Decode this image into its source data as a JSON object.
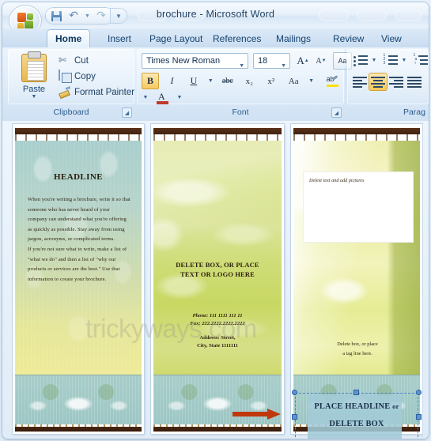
{
  "window": {
    "title": "brochure - Microsoft Word",
    "office_button": "office-button",
    "quick_access": [
      {
        "name": "save",
        "label": "Save",
        "icon": "save-icon"
      },
      {
        "name": "undo",
        "label": "Undo",
        "icon": "undo-icon"
      },
      {
        "name": "redo",
        "label": "Redo",
        "icon": "redo-icon"
      }
    ],
    "customize_qat": "Customize Quick Access Toolbar"
  },
  "tabs": [
    {
      "id": "home",
      "label": "Home",
      "active": true
    },
    {
      "id": "insert",
      "label": "Insert",
      "active": false
    },
    {
      "id": "page-layout",
      "label": "Page Layout",
      "active": false
    },
    {
      "id": "references",
      "label": "References",
      "active": false
    },
    {
      "id": "mailings",
      "label": "Mailings",
      "active": false
    },
    {
      "id": "review",
      "label": "Review",
      "active": false
    },
    {
      "id": "view",
      "label": "View",
      "active": false
    }
  ],
  "ribbon": {
    "clipboard": {
      "group_label": "Clipboard",
      "paste_label": "Paste",
      "items": [
        {
          "label": "Cut",
          "icon": "scissors-icon"
        },
        {
          "label": "Copy",
          "icon": "copy-icon"
        },
        {
          "label": "Format Painter",
          "icon": "paintbrush-icon"
        }
      ]
    },
    "font": {
      "group_label": "Font",
      "font_name": "Times New Roman",
      "font_size": "18",
      "grow_font": "A",
      "shrink_font": "A",
      "clear_formatting": "Aa",
      "bold": "B",
      "italic": "I",
      "underline": "U",
      "strikethrough": "abc",
      "subscript": "x₂",
      "superscript": "x²",
      "change_case": "Aa",
      "highlight": "ab",
      "font_color": "A"
    },
    "paragraph": {
      "group_label": "Parag",
      "bullets": "Bullets",
      "numbering": "Numbering",
      "multilevel": "Multilevel List",
      "align_left": "Align Text Left",
      "align_center": "Center",
      "align_right": "Align Text Right",
      "justify": "Justify",
      "active_alignment": "align_center"
    }
  },
  "document": {
    "watermark": "trickyways.com",
    "panel_left": {
      "headline": "HEADLINE",
      "paragraphs": [
        "When you're writing a brochure, write it so that someone who has never heard of your company can understand what you're offering as quickly as possible. Stay away from using jargon, acronyms, or complicated terms.",
        "If you're not sure what to write, make a list of \"what we do\" and then a list of \"why our products or services are the best.\" Use that information to create your brochure."
      ]
    },
    "panel_middle": {
      "delete_box_line1": "DELETE BOX, OR PLACE",
      "delete_box_line2": "TEXT OR LOGO HERE",
      "phone_label": "Phone:",
      "phone_value": "111 1111 111 11",
      "fax_label": "Fax:",
      "fax_value": "222.2222.2222.2222",
      "address_line1": "Address: Street,",
      "address_line2": "City, State 1111111"
    },
    "panel_right": {
      "picture_placeholder": "Delete text and add pictures",
      "headline_line1": "PLACE HEADLINE",
      "headline_or": "or",
      "headline_line2": "DELETE BOX",
      "tagline_line1": "Delete box, or place",
      "tagline_line2": "a tag line here."
    },
    "annotation": {
      "type": "red-arrow",
      "color": "#C0390D"
    }
  },
  "colors": {
    "accent_blue": "#5B94D6",
    "arrow_red": "#C0390D",
    "textbox_fill": "#A2CBD7",
    "ribbon_text": "#15426E"
  }
}
